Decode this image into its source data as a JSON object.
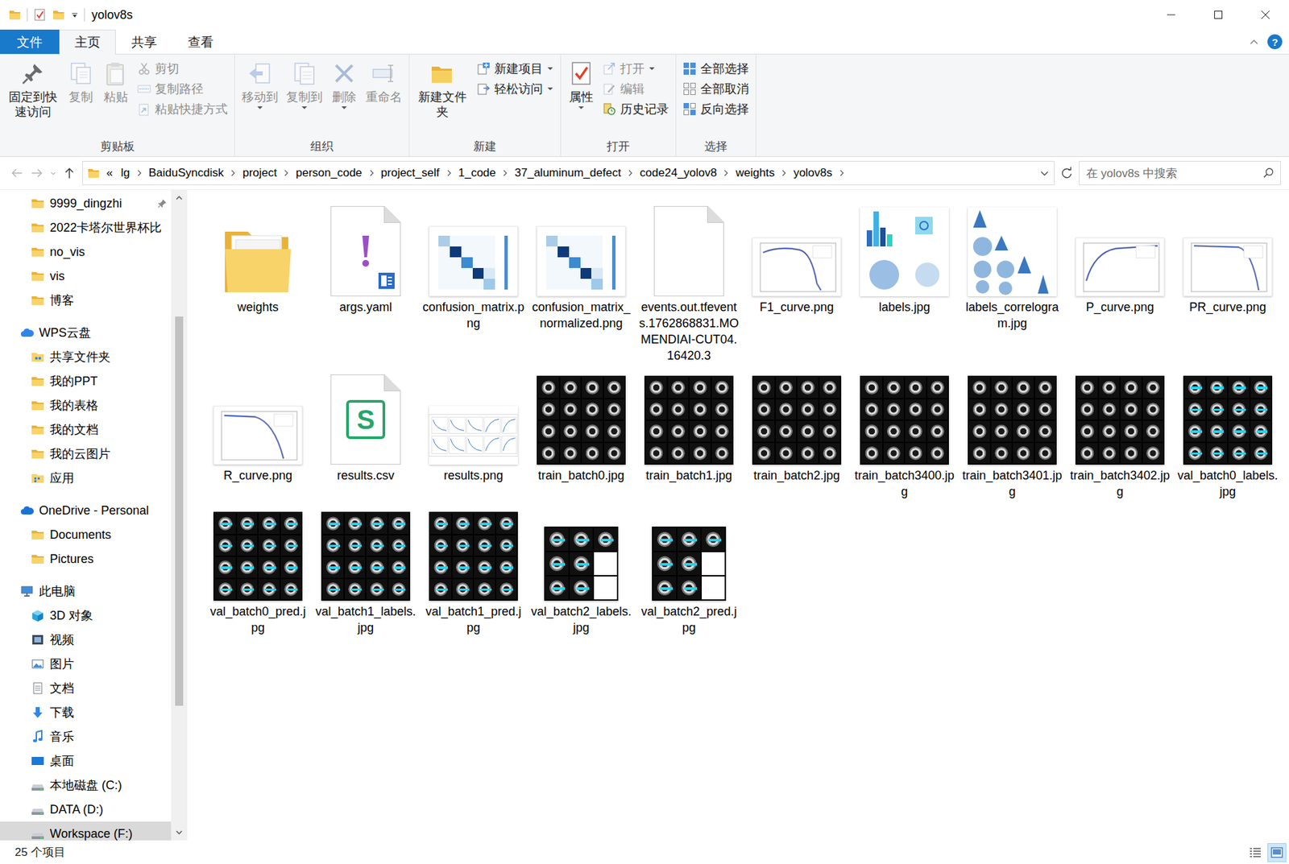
{
  "window": {
    "title": "yolov8s"
  },
  "ribbon_tabs": [
    {
      "label": "文件",
      "selected": false,
      "kind": "file-menu"
    },
    {
      "label": "主页",
      "selected": true,
      "kind": "tab"
    },
    {
      "label": "共享",
      "selected": false,
      "kind": "tab"
    },
    {
      "label": "查看",
      "selected": false,
      "kind": "tab"
    }
  ],
  "help": "?",
  "ribbon_groups": [
    {
      "label": "剪贴板",
      "large": [
        {
          "label": "固定到快速访问",
          "kind": "pin",
          "disabled": false,
          "dropdown": false
        },
        {
          "label": "复制",
          "kind": "copy",
          "disabled": true,
          "dropdown": false
        },
        {
          "label": "粘贴",
          "kind": "paste",
          "disabled": true,
          "dropdown": false
        }
      ],
      "small": [
        {
          "label": "剪切",
          "kind": "cut",
          "disabled": true,
          "dropdown": false
        },
        {
          "label": "复制路径",
          "kind": "copypath",
          "disabled": true,
          "dropdown": false
        },
        {
          "label": "粘贴快捷方式",
          "kind": "pasteshortcut",
          "disabled": true,
          "dropdown": false
        }
      ]
    },
    {
      "label": "组织",
      "large": [
        {
          "label": "移动到",
          "kind": "moveto",
          "disabled": true,
          "dropdown": true
        },
        {
          "label": "复制到",
          "kind": "copyto",
          "disabled": true,
          "dropdown": true
        },
        {
          "label": "删除",
          "kind": "delete",
          "disabled": true,
          "dropdown": true
        },
        {
          "label": "重命名",
          "kind": "rename",
          "disabled": true,
          "dropdown": false
        }
      ],
      "small": []
    },
    {
      "label": "新建",
      "large": [
        {
          "label": "新建文件夹",
          "kind": "newfolder",
          "disabled": false,
          "dropdown": false
        }
      ],
      "small": [
        {
          "label": "新建项目",
          "kind": "newitem",
          "disabled": false,
          "dropdown": true
        },
        {
          "label": "轻松访问",
          "kind": "easyaccess",
          "disabled": false,
          "dropdown": true
        }
      ]
    },
    {
      "label": "打开",
      "large": [
        {
          "label": "属性",
          "kind": "properties",
          "disabled": false,
          "dropdown": true
        }
      ],
      "small": [
        {
          "label": "打开",
          "kind": "open",
          "disabled": true,
          "dropdown": true
        },
        {
          "label": "编辑",
          "kind": "edit",
          "disabled": true,
          "dropdown": false
        },
        {
          "label": "历史记录",
          "kind": "history",
          "disabled": false,
          "dropdown": false
        }
      ]
    },
    {
      "label": "选择",
      "large": [],
      "small": [
        {
          "label": "全部选择",
          "kind": "selectall",
          "disabled": false,
          "dropdown": false
        },
        {
          "label": "全部取消",
          "kind": "selectnone",
          "disabled": false,
          "dropdown": false
        },
        {
          "label": "反向选择",
          "kind": "invert",
          "disabled": false,
          "dropdown": false
        }
      ]
    }
  ],
  "address": {
    "overflow": "«",
    "crumbs": [
      "lg",
      "BaiduSyncdisk",
      "project",
      "person_code",
      "project_self",
      "1_code",
      "37_aluminum_defect",
      "code24_yolov8",
      "weights",
      "yolov8s"
    ],
    "search_placeholder": "在 yolov8s 中搜索"
  },
  "sidebar": {
    "items": [
      {
        "label": "9999_dingzhi",
        "kind": "folder",
        "pinned": true,
        "selected": false
      },
      {
        "label": "2022卡塔尔世界杯比",
        "kind": "folder",
        "pinned": false,
        "selected": false
      },
      {
        "label": "no_vis",
        "kind": "folder",
        "pinned": false,
        "selected": false
      },
      {
        "label": "vis",
        "kind": "folder",
        "pinned": false,
        "selected": false
      },
      {
        "label": "博客",
        "kind": "folder",
        "pinned": false,
        "selected": false
      },
      {
        "label": "WPS云盘",
        "kind": "wps",
        "pinned": false,
        "selected": false
      },
      {
        "label": "共享文件夹",
        "kind": "shared",
        "pinned": false,
        "selected": false
      },
      {
        "label": "我的PPT",
        "kind": "folder",
        "pinned": false,
        "selected": false
      },
      {
        "label": "我的表格",
        "kind": "folder",
        "pinned": false,
        "selected": false
      },
      {
        "label": "我的文档",
        "kind": "folder",
        "pinned": false,
        "selected": false
      },
      {
        "label": "我的云图片",
        "kind": "folder",
        "pinned": false,
        "selected": false
      },
      {
        "label": "应用",
        "kind": "apps",
        "pinned": false,
        "selected": false
      },
      {
        "label": "OneDrive - Personal",
        "kind": "onedrive",
        "pinned": false,
        "selected": false
      },
      {
        "label": "Documents",
        "kind": "folder",
        "pinned": false,
        "selected": false
      },
      {
        "label": "Pictures",
        "kind": "folder",
        "pinned": false,
        "selected": false
      },
      {
        "label": "此电脑",
        "kind": "pc",
        "pinned": false,
        "selected": false
      },
      {
        "label": "3D 对象",
        "kind": "obj3d",
        "pinned": false,
        "selected": false
      },
      {
        "label": "视频",
        "kind": "video",
        "pinned": false,
        "selected": false
      },
      {
        "label": "图片",
        "kind": "picture",
        "pinned": false,
        "selected": false
      },
      {
        "label": "文档",
        "kind": "document",
        "pinned": false,
        "selected": false
      },
      {
        "label": "下载",
        "kind": "download",
        "pinned": false,
        "selected": false
      },
      {
        "label": "音乐",
        "kind": "music",
        "pinned": false,
        "selected": false
      },
      {
        "label": "桌面",
        "kind": "desktop",
        "pinned": false,
        "selected": false
      },
      {
        "label": "本地磁盘 (C:)",
        "kind": "drive",
        "pinned": false,
        "selected": false
      },
      {
        "label": "DATA (D:)",
        "kind": "drive",
        "pinned": false,
        "selected": false
      },
      {
        "label": "Workspace (F:)",
        "kind": "drive",
        "pinned": false,
        "selected": true
      }
    ]
  },
  "files": [
    {
      "name": "weights",
      "kind": "folder"
    },
    {
      "name": "args.yaml",
      "kind": "yaml"
    },
    {
      "name": "confusion_matrix.png",
      "kind": "matrix"
    },
    {
      "name": "confusion_matrix_normalized.png",
      "kind": "matrix"
    },
    {
      "name": "events.out.tfevents.1762868831.MOMENDIAI-CUT04.16420.3",
      "kind": "blank"
    },
    {
      "name": "F1_curve.png",
      "kind": "curve-f1"
    },
    {
      "name": "labels.jpg",
      "kind": "labels"
    },
    {
      "name": "labels_correlogram.jpg",
      "kind": "correlogram"
    },
    {
      "name": "P_curve.png",
      "kind": "curve-p"
    },
    {
      "name": "PR_curve.png",
      "kind": "curve-pr"
    },
    {
      "name": "R_curve.png",
      "kind": "curve-r"
    },
    {
      "name": "results.csv",
      "kind": "csv",
      "badge": "S"
    },
    {
      "name": "results.png",
      "kind": "results"
    },
    {
      "name": "train_batch0.jpg",
      "kind": "batch"
    },
    {
      "name": "train_batch1.jpg",
      "kind": "batch"
    },
    {
      "name": "train_batch2.jpg",
      "kind": "batch"
    },
    {
      "name": "train_batch3400.jpg",
      "kind": "batch"
    },
    {
      "name": "train_batch3401.jpg",
      "kind": "batch"
    },
    {
      "name": "train_batch3402.jpg",
      "kind": "batch"
    },
    {
      "name": "val_batch0_labels.jpg",
      "kind": "batch-labeled"
    },
    {
      "name": "val_batch0_pred.jpg",
      "kind": "batch-labeled"
    },
    {
      "name": "val_batch1_labels.jpg",
      "kind": "batch-labeled"
    },
    {
      "name": "val_batch1_pred.jpg",
      "kind": "batch-labeled"
    },
    {
      "name": "val_batch2_labels.jpg",
      "kind": "batch-partial"
    },
    {
      "name": "val_batch2_pred.jpg",
      "kind": "batch-partial"
    }
  ],
  "status_bar": {
    "count": "25 个项目",
    "views": [
      {
        "kind": "details",
        "selected": false
      },
      {
        "kind": "thumbnails",
        "selected": true
      }
    ]
  }
}
